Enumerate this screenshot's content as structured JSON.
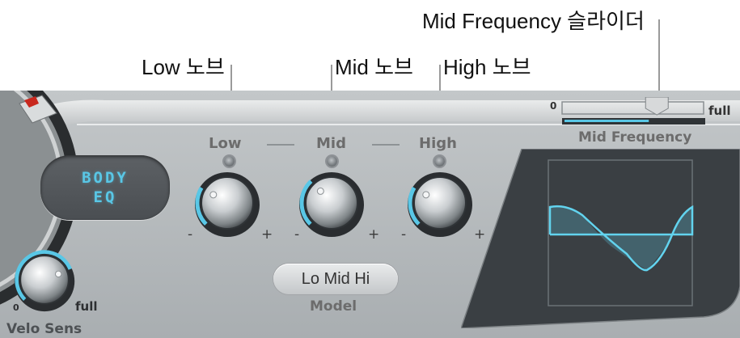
{
  "callouts": {
    "low_knob": "Low 노브",
    "mid_knob": "Mid 노브",
    "high_knob": "High 노브",
    "mid_frequency_slider": "Mid Frequency 슬라이더"
  },
  "panel": {
    "knob_labels": {
      "low": "Low",
      "mid": "Mid",
      "high": "High"
    },
    "minus": "-",
    "plus": "+",
    "body_eq_button": {
      "line1": "BODY",
      "line2": "EQ"
    },
    "model": {
      "value": "Lo Mid Hi",
      "label": "Model"
    },
    "mid_frequency": {
      "label": "Mid Frequency",
      "min_label": "0",
      "max_label": "full",
      "value": 0.68
    },
    "velo_sens": {
      "label": "Velo Sens",
      "min_label": "0",
      "max_label": "full",
      "value": 0.75
    },
    "knobs": {
      "low": 0.28,
      "mid": 0.34,
      "high": 0.28
    }
  },
  "colors": {
    "accent": "#59c7e6",
    "panel": "#b7bcbf",
    "display": "#3d4246"
  }
}
